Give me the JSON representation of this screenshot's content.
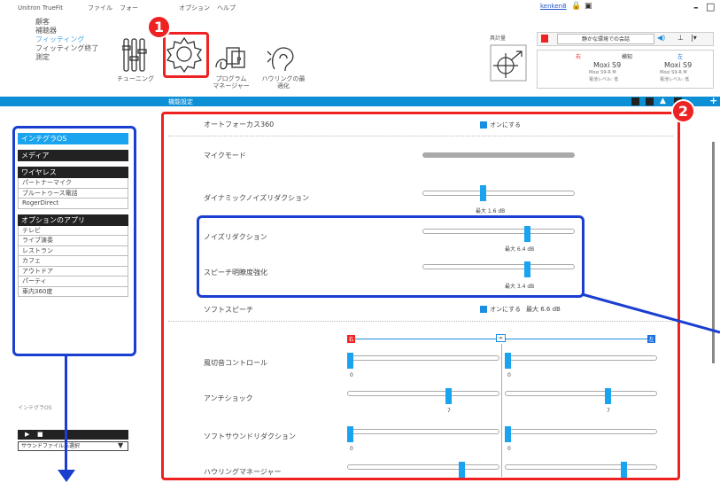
{
  "app": {
    "brand": "Unitron TrueFit",
    "menu": [
      "ファイル",
      "フォー",
      "オプション",
      "ヘルプ"
    ],
    "user": "kenken8"
  },
  "left_nav": [
    "顧客",
    "補聴器",
    "フィッティング",
    "フィッティング終了",
    "測定"
  ],
  "ribbon": {
    "tuning": "チューニング",
    "program_manager_1": "プログラム",
    "program_manager_2": "マネージャー",
    "howling_1": "ハウリングの最",
    "howling_2": "適化",
    "gauge_label": "具計量",
    "environment": "静かな環境での会話",
    "right_label": "右",
    "mark": "検知",
    "left_label": "左",
    "device_r": "Moxi S9",
    "device_l": "Moxi S9",
    "device_sub_r": "Moxi S9-R M",
    "device_sub_l": "Moxi S9-R M",
    "device_sub2_r": "電池レベル: 低",
    "device_sub2_l": "電池レベル: 低"
  },
  "blue_bar_title": "機能設定",
  "callouts": {
    "one": "1",
    "two": "2"
  },
  "sidebar": {
    "selected": "インテグラOS",
    "media": "メディア",
    "wireless": "ワイヤレス",
    "wireless_items": [
      "パートナーマイク",
      "ブルートゥース電話",
      "RogerDirect"
    ],
    "apps_head": "オプションのアプリ",
    "app_items": [
      "テレビ",
      "ライブ演奏",
      "レストラン",
      "カフェ",
      "アウトドア",
      "パーティ",
      "車内360度"
    ],
    "footer_label": "インテグラOS",
    "sound_file": "サウンドファイル未選択"
  },
  "main": {
    "autofocus": "オートフォーカス360",
    "autofocus_check": "オンにする",
    "mic_mode": "マイクモード",
    "dnr": "ダイナミックノイズリダクション",
    "dnr_value": "最大 1.6 dB",
    "dnr_level": 0.4,
    "nr": "ノイズリダクション",
    "nr_value": "最大 6.4 dB",
    "nr_level": 0.69,
    "se": "スピーチ明瞭度強化",
    "se_value": "最大 3.4 dB",
    "se_level": 0.69,
    "soft_speech": "ソフトスピーチ",
    "soft_speech_check": "オンにする",
    "soft_speech_value": "最大 6.6 dB",
    "right_tag": "右",
    "left_tag": "左",
    "wind": "風切音コントロール",
    "wind_r": "0",
    "wind_l": "0",
    "anti_shock": "アンチショック",
    "anti_shock_r": "7",
    "anti_shock_l": "7",
    "soft_sound": "ソフトサウンドリダクション",
    "soft_sound_r": "0",
    "soft_sound_l": "0",
    "howling": "ハウリングマネージャー"
  },
  "colors": {
    "accent": "#0d8fd6",
    "callout_red": "#e22222",
    "callout_blue": "#1a3fd0"
  }
}
